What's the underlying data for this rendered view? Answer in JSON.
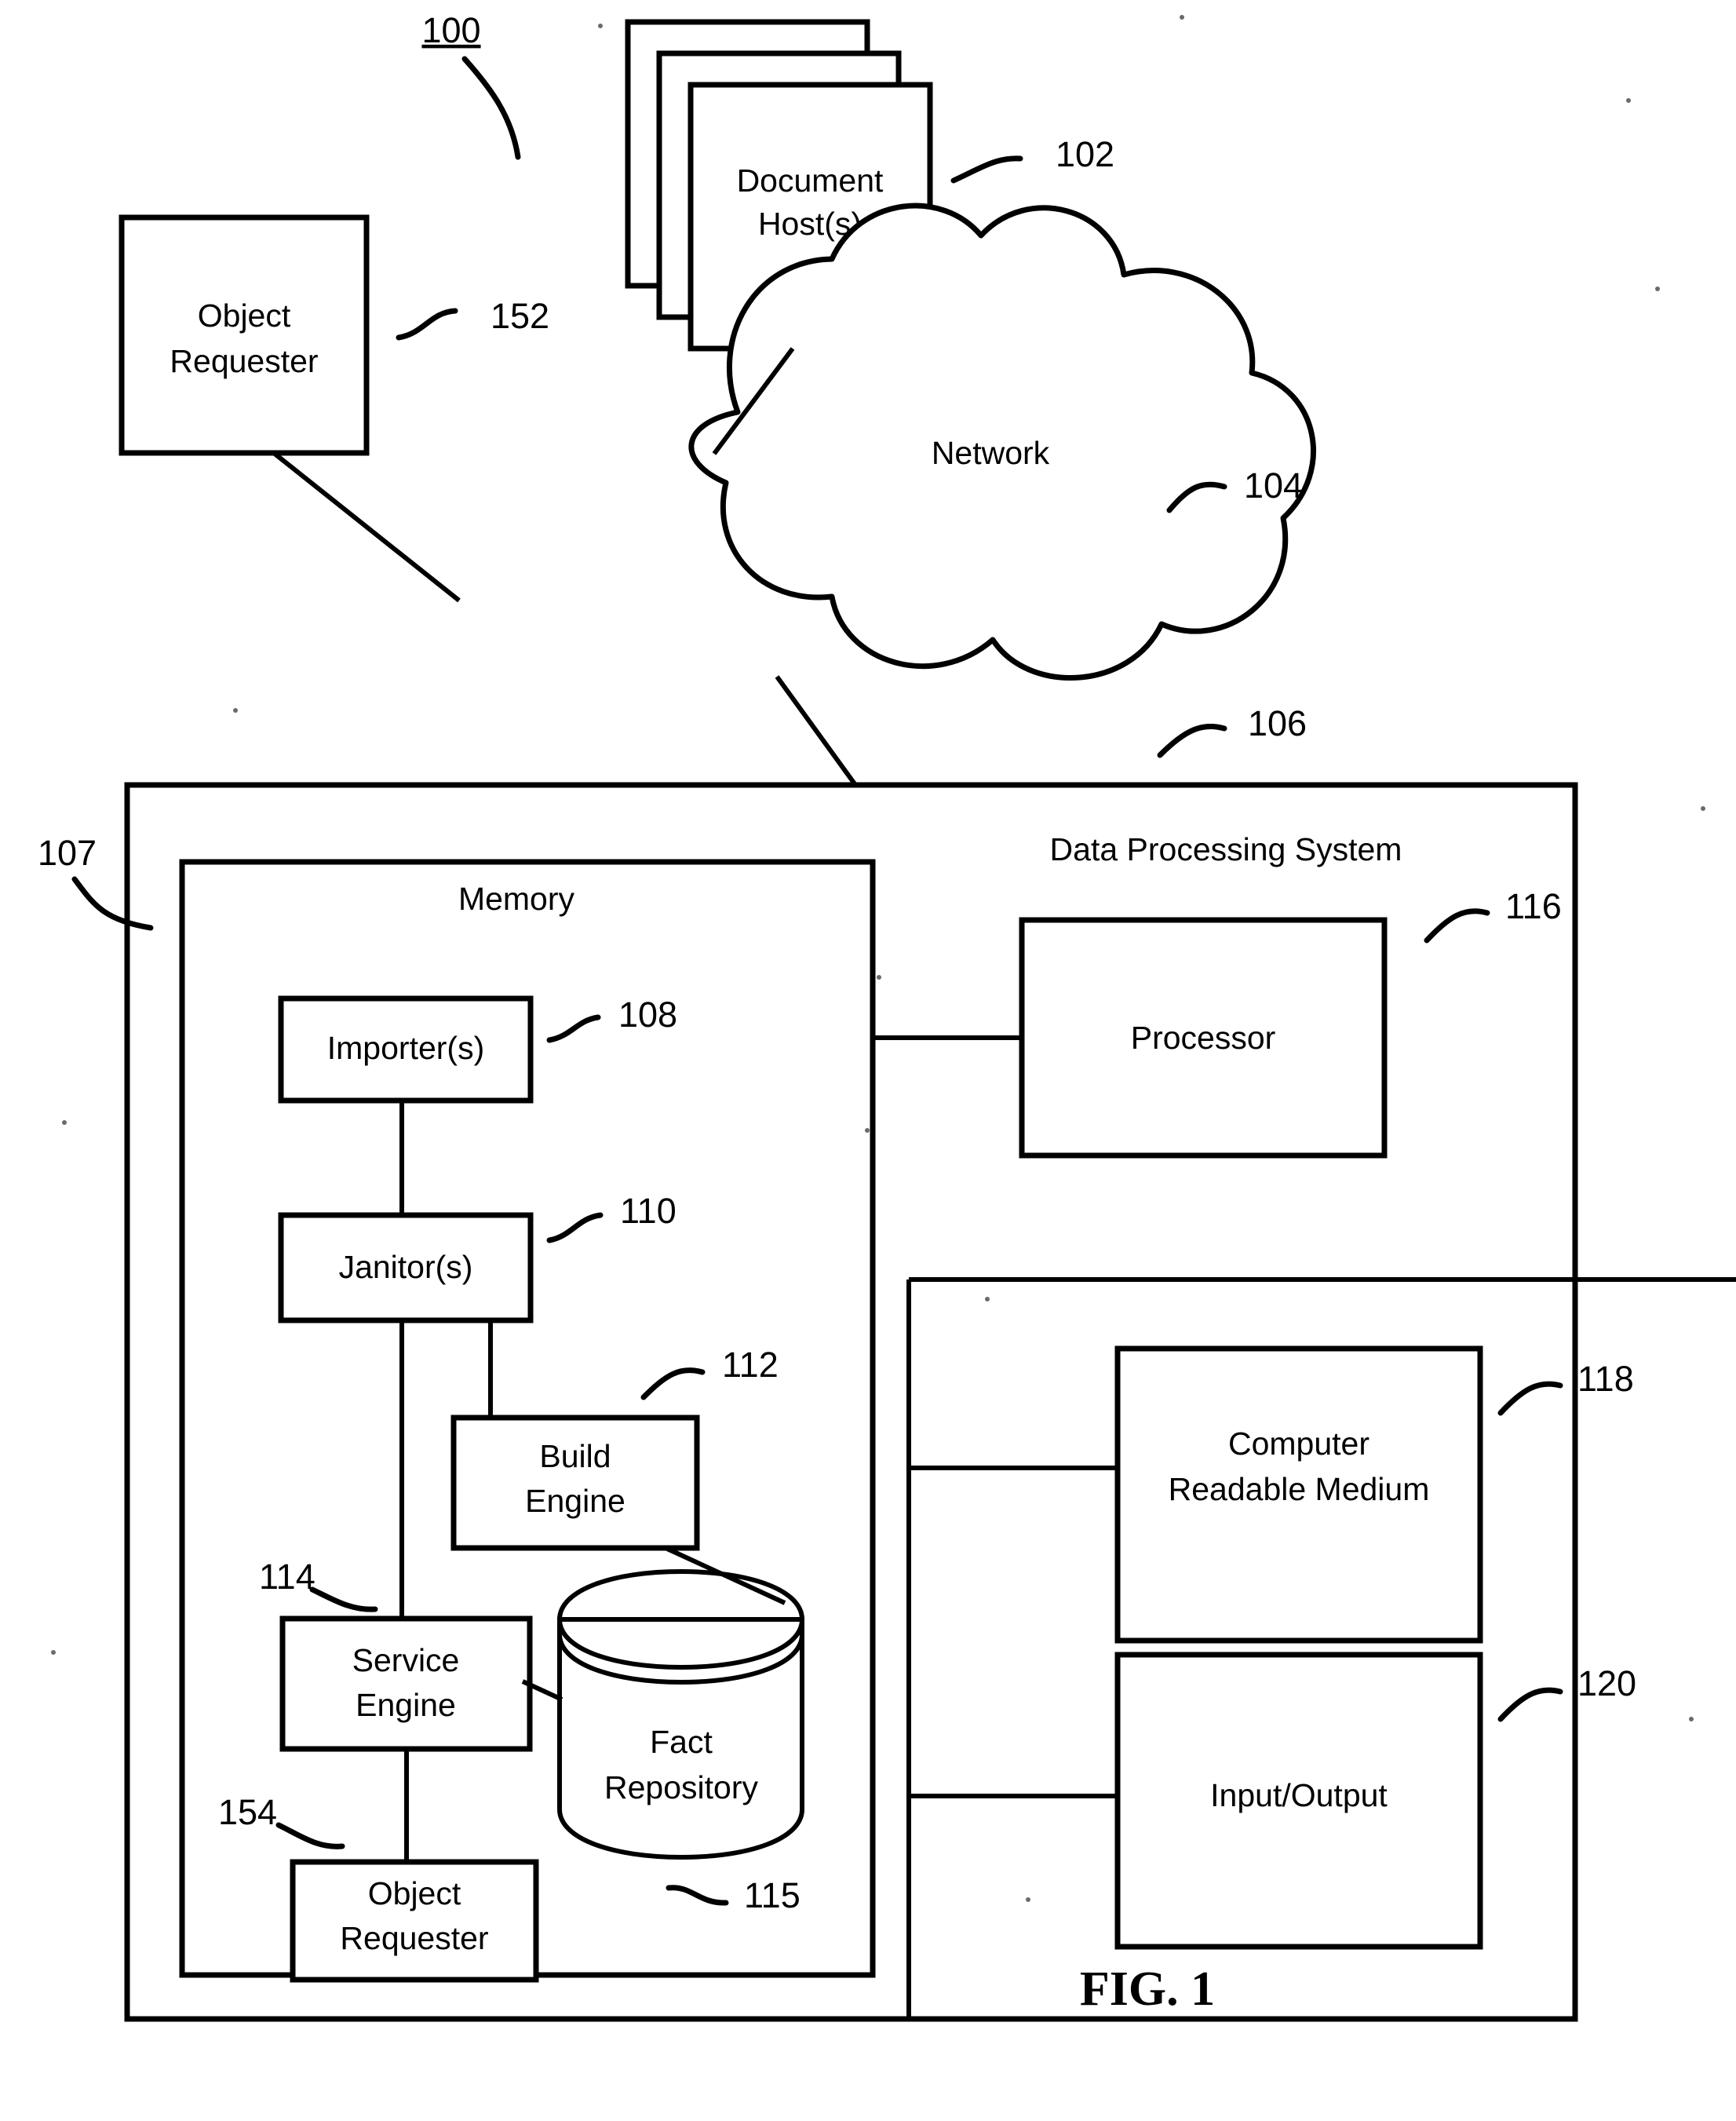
{
  "figure": {
    "label": "FIG. 1",
    "system_number": "100"
  },
  "nodes": {
    "document_hosts": {
      "label_line1": "Document",
      "label_line2": "Host(s)",
      "ref": "102"
    },
    "object_requester_external": {
      "label_line1": "Object",
      "label_line2": "Requester",
      "ref": "152"
    },
    "network": {
      "label": "Network",
      "ref": "104"
    },
    "data_processing_system": {
      "label": "Data Processing System",
      "ref": "106"
    },
    "dps_inner_ref": {
      "ref": "107"
    },
    "memory": {
      "label": "Memory"
    },
    "importers": {
      "label": "Importer(s)",
      "ref": "108"
    },
    "janitors": {
      "label": "Janitor(s)",
      "ref": "110"
    },
    "build_engine": {
      "label_line1": "Build",
      "label_line2": "Engine",
      "ref": "112"
    },
    "service_engine": {
      "label_line1": "Service",
      "label_line2": "Engine",
      "ref": "114"
    },
    "fact_repository": {
      "label_line1": "Fact",
      "label_line2": "Repository",
      "ref": "115"
    },
    "object_requester_internal": {
      "label_line1": "Object",
      "label_line2": "Requester",
      "ref": "154"
    },
    "processor": {
      "label": "Processor",
      "ref": "116"
    },
    "computer_readable_medium": {
      "label_line1": "Computer",
      "label_line2": "Readable Medium",
      "ref": "118"
    },
    "input_output": {
      "label": "Input/Output",
      "ref": "120"
    }
  },
  "colors": {
    "stroke": "#000000",
    "background": "#ffffff"
  }
}
